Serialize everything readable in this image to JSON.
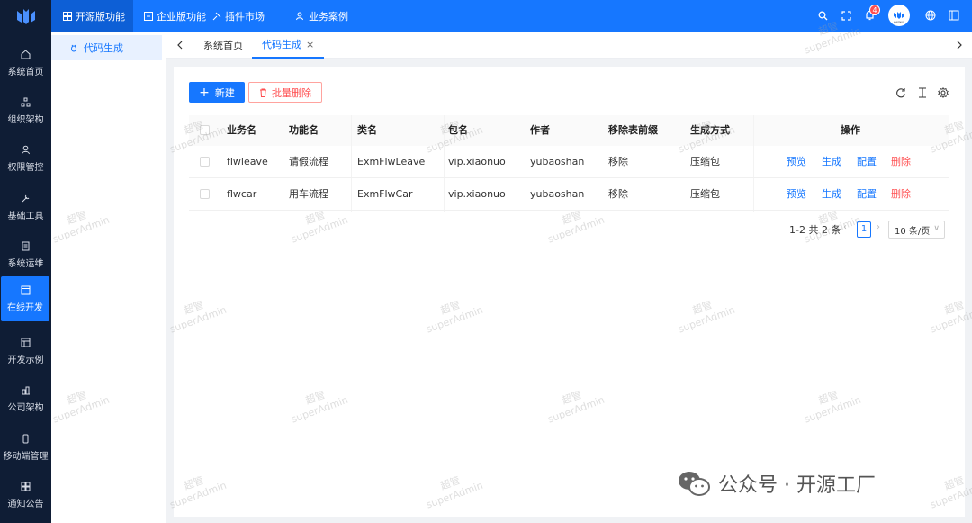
{
  "top_nav": {
    "tabs": [
      {
        "label": "开源版功能",
        "icon": "grid-icon"
      },
      {
        "label": "企业版功能",
        "icon": "layout-icon"
      },
      {
        "label": "插件市场",
        "icon": "plugin-icon"
      },
      {
        "label": "业务案例",
        "icon": "users-icon"
      }
    ],
    "notification_count": "4",
    "avatar_text": "XIAONUO"
  },
  "left_rail": {
    "items": [
      {
        "label": "系统首页",
        "icon": "home-icon"
      },
      {
        "label": "组织架构",
        "icon": "org-icon"
      },
      {
        "label": "权限管控",
        "icon": "user-icon"
      },
      {
        "label": "基础工具",
        "icon": "tool-icon"
      },
      {
        "label": "系统运维",
        "icon": "doc-icon"
      },
      {
        "label": "在线开发",
        "icon": "code-icon"
      },
      {
        "label": "开发示例",
        "icon": "example-icon"
      },
      {
        "label": "公司架构",
        "icon": "company-icon"
      },
      {
        "label": "移动端管理",
        "icon": "mobile-icon"
      },
      {
        "label": "通知公告",
        "icon": "notice-icon"
      }
    ],
    "active": "在线开发"
  },
  "sub_menu": {
    "item": "代码生成"
  },
  "page_tabs": [
    {
      "label": "系统首页"
    },
    {
      "label": "代码生成"
    }
  ],
  "toolbar": {
    "new_label": "新建",
    "batch_delete_label": "批量删除"
  },
  "table": {
    "columns": [
      "业务名",
      "功能名",
      "类名",
      "包名",
      "作者",
      "移除表前缀",
      "生成方式",
      "操作"
    ],
    "rows": [
      {
        "business": "flwleave",
        "function": "请假流程",
        "class": "ExmFlwLeave",
        "package": "vip.xiaonuo",
        "author": "yubaoshan",
        "remove_prefix": "移除",
        "gen_type": "压缩包"
      },
      {
        "business": "flwcar",
        "function": "用车流程",
        "class": "ExmFlwCar",
        "package": "vip.xiaonuo",
        "author": "yubaoshan",
        "remove_prefix": "移除",
        "gen_type": "压缩包"
      }
    ],
    "actions": [
      "预览",
      "生成",
      "配置",
      "删除"
    ]
  },
  "pagination": {
    "summary": "1-2 共 2 条",
    "current_page": "1",
    "page_size": "10 条/页"
  },
  "watermark": {
    "line1": "超管",
    "line2": "superAdmin"
  },
  "footer_brand": "公众号 · 开源工厂",
  "colors": {
    "primary": "#1677ff",
    "rail": "#0f1d35",
    "danger": "#ff4d4f"
  }
}
